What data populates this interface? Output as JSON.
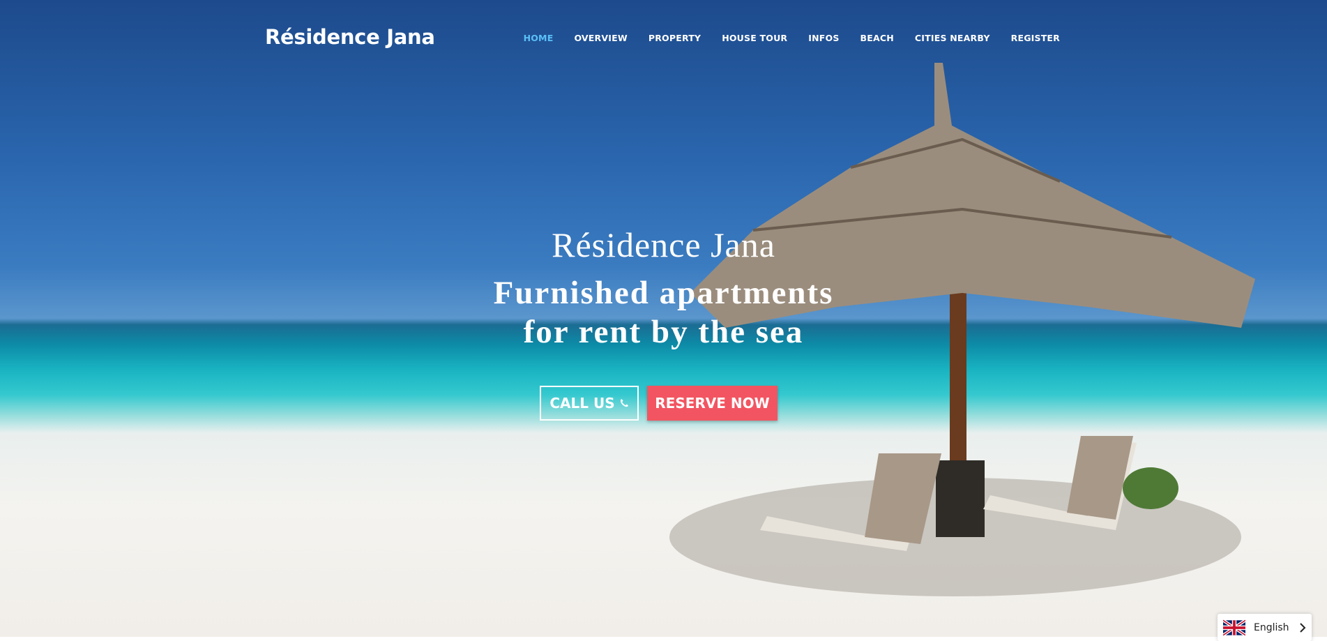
{
  "header": {
    "logo": "Résidence Jana",
    "nav": [
      {
        "label": "HOME"
      },
      {
        "label": "OVERVIEW"
      },
      {
        "label": "PROPERTY"
      },
      {
        "label": "HOUSE TOUR"
      },
      {
        "label": "INFOS"
      },
      {
        "label": "BEACH"
      },
      {
        "label": "CITIES NEARBY"
      },
      {
        "label": "REGISTER"
      }
    ],
    "active_color": "#5bc0f8"
  },
  "hero": {
    "title": "Résidence Jana",
    "subtitle_line1": "Furnished apartments",
    "subtitle_line2": "for rent by the sea",
    "call_label": "CALL US",
    "call_icon": "phone-icon",
    "reserve_label": "RESERVE NOW",
    "reserve_color": "#f25561"
  },
  "language": {
    "label": "English",
    "flag_icon": "uk-flag-icon",
    "chevron_icon": "chevron-right-icon"
  }
}
